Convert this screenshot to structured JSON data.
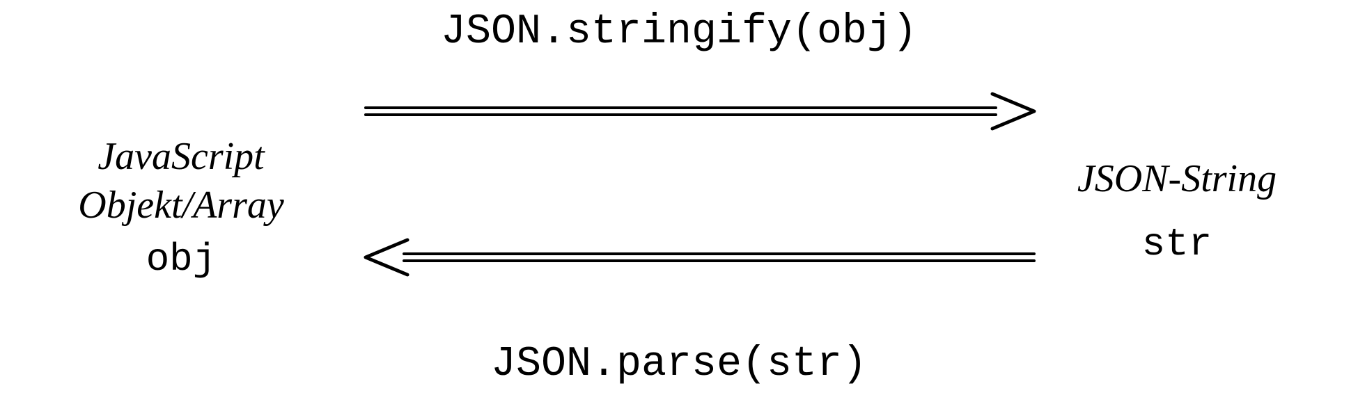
{
  "diagram": {
    "left": {
      "line1": "JavaScript",
      "line2": "Objekt/Array",
      "line3": "obj"
    },
    "right": {
      "line1": "JSON-String",
      "line2": "str"
    },
    "top_label": "JSON.stringify(obj)",
    "bottom_label": "JSON.parse(str)"
  }
}
